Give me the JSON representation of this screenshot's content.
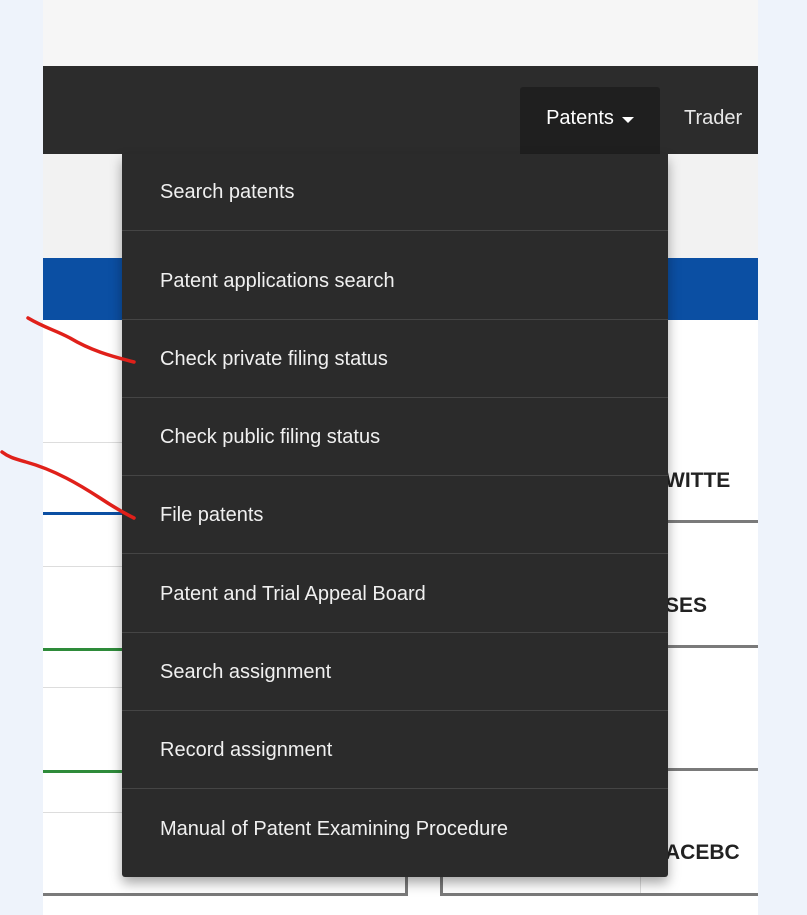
{
  "navbar": {
    "patents_label": "Patents",
    "trademarks_label": "Trader"
  },
  "dropdown": {
    "items": [
      {
        "label": "Search patents"
      },
      {
        "label": "Patent applications search"
      },
      {
        "label": "Check private filing status"
      },
      {
        "label": "Check public filing status"
      },
      {
        "label": "File patents"
      },
      {
        "label": "Patent and Trial Appeal Board"
      },
      {
        "label": "Search assignment"
      },
      {
        "label": "Record assignment"
      },
      {
        "label": "Manual of Patent Examining Procedure"
      }
    ]
  },
  "background_cards": {
    "twitter_fragment": "WITTE",
    "uses_fragment": "SES",
    "facebook_fragment": "ACEBC"
  },
  "colors": {
    "navbar": "#2c2c2c",
    "dropdown": "#2b2b2b",
    "blue_band": "#0b4fa3",
    "annotation": "#e0201a"
  }
}
